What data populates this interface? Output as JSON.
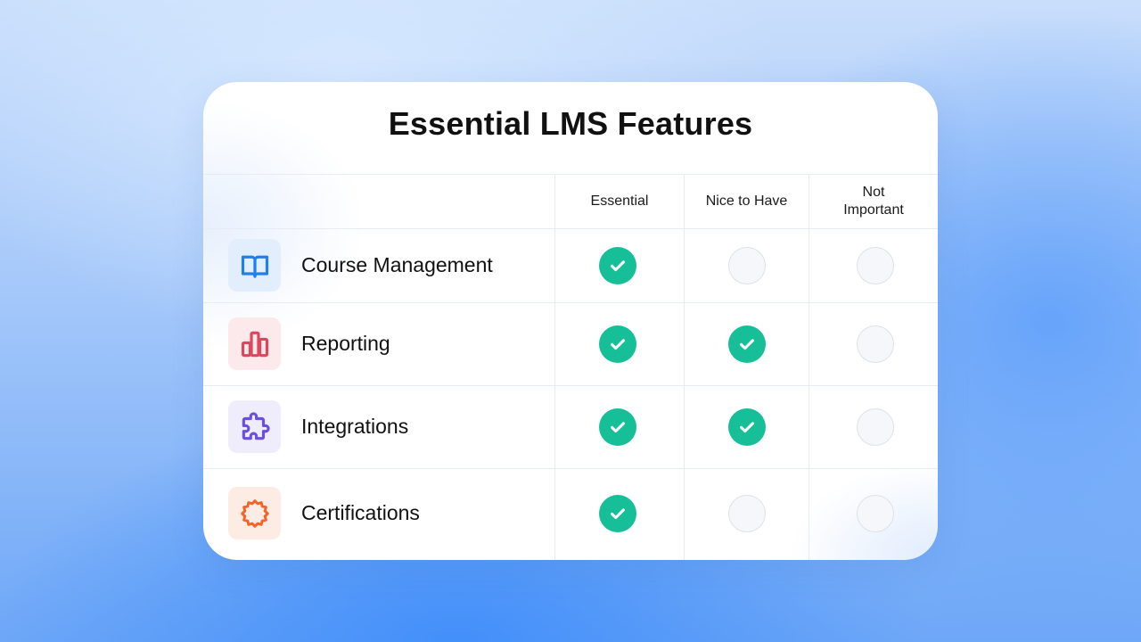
{
  "title": "Essential LMS Features",
  "columns": [
    "Essential",
    "Nice to Have",
    "Not\nImportant"
  ],
  "colors": {
    "check": "#17bf98",
    "empty_fill": "#f6f7fa",
    "empty_border": "#dde2ea"
  },
  "features": [
    {
      "label": "Course Management",
      "icon": "book-icon",
      "icon_color": "#1f7ff0",
      "icon_bg": "#e3eefc",
      "ratings": [
        true,
        false,
        false
      ]
    },
    {
      "label": "Reporting",
      "icon": "bar-chart-icon",
      "icon_color": "#e0455f",
      "icon_bg": "#fbe9ec",
      "ratings": [
        true,
        true,
        false
      ]
    },
    {
      "label": "Integrations",
      "icon": "puzzle-icon",
      "icon_color": "#6c4fe0",
      "icon_bg": "#efedfb",
      "ratings": [
        true,
        true,
        false
      ]
    },
    {
      "label": "Certifications",
      "icon": "badge-icon",
      "icon_color": "#f0662a",
      "icon_bg": "#fcece4",
      "ratings": [
        true,
        false,
        false
      ]
    }
  ]
}
